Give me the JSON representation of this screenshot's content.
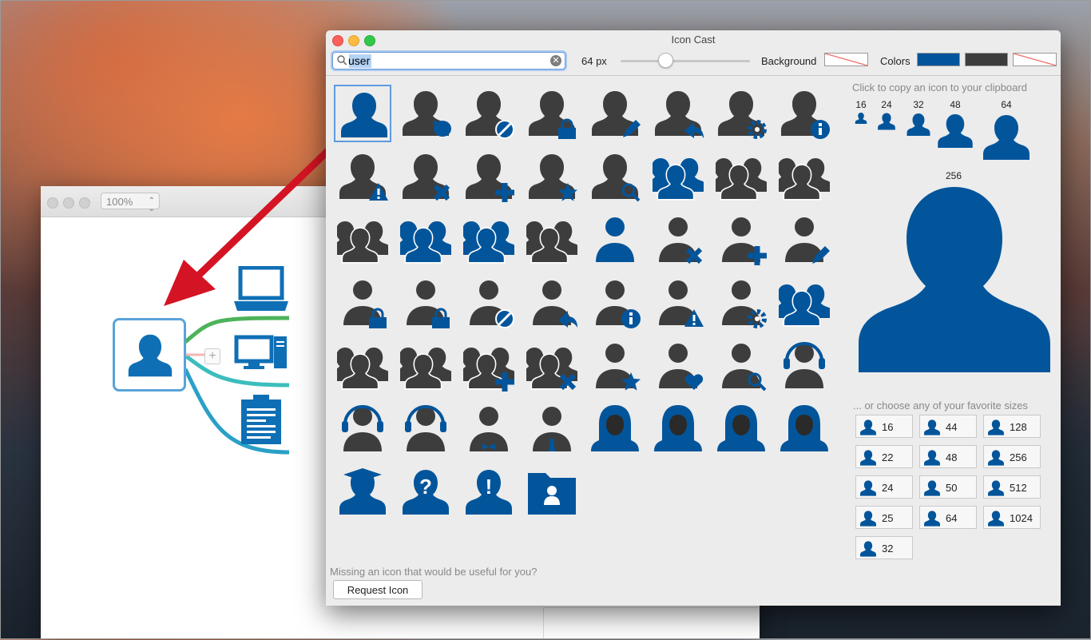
{
  "background_window": {
    "zoom": "100%"
  },
  "window": {
    "title": "Icon Cast"
  },
  "toolbar": {
    "search_value": "user",
    "size_label": "64 px",
    "size_fraction": 0.34,
    "background_label": "Background",
    "colors_label": "Colors",
    "colors": [
      "#03559b",
      "#3d3d3d"
    ]
  },
  "grid": {
    "icons": [
      "user-icon",
      "user-comment-icon",
      "user-blocked-icon",
      "user-lock-icon",
      "user-edit-icon",
      "user-reply-icon",
      "user-settings-icon",
      "user-info-icon",
      "user-warning-icon",
      "user-remove-icon",
      "user-add-icon",
      "user-star-icon",
      "user-search-icon",
      "user-group-icon",
      "user-team-icon",
      "user-meeting-icon",
      "user-crowd-icon",
      "user-group-small-icon",
      "user-people-standing-icon",
      "user-crowd-large-icon",
      "user-round-icon",
      "user-round-remove-icon",
      "user-round-add-icon",
      "user-round-edit-icon",
      "user-round-lock-icon",
      "user-round-unlock-icon",
      "user-round-blocked-icon",
      "user-round-reply-icon",
      "user-round-info-icon",
      "user-round-warning-icon",
      "user-round-settings-icon",
      "user-round-pair-icon",
      "user-round-group-icon",
      "user-round-presentation-icon",
      "user-round-pair-add-icon",
      "user-round-pair-remove-icon",
      "user-round-star-icon",
      "user-round-heart-icon",
      "user-round-search-icon",
      "user-round-headset-icon",
      "user-headphones-icon",
      "user-headset-mic-icon",
      "user-bowtie-icon",
      "user-tie-icon",
      "user-female-icon",
      "user-female-bob-icon",
      "user-female-long-icon",
      "user-female-wavy-icon",
      "user-graduate-icon",
      "user-question-icon",
      "user-exclamation-icon",
      "user-folder-icon"
    ]
  },
  "panel": {
    "hint": "Click to copy an icon to your clipboard",
    "preview_sizes": [
      "16",
      "24",
      "32",
      "48",
      "64"
    ],
    "large_size": "256",
    "choose_text": "... or choose any of your favorite sizes",
    "favorite_sizes": [
      "16",
      "44",
      "128",
      "22",
      "48",
      "256",
      "24",
      "50",
      "512",
      "25",
      "64",
      "1024",
      "32"
    ]
  },
  "footer": {
    "missing_text": "Missing an icon that would be useful for you?",
    "request_label": "Request Icon"
  }
}
